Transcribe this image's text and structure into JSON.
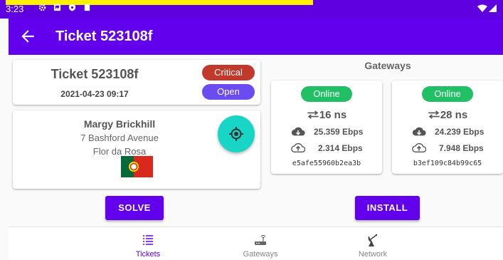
{
  "status_bar": {
    "time": "3:23",
    "icons": [
      "settings-icon",
      "photo-icon",
      "shield-icon",
      "sd-card-icon"
    ],
    "right_icons": [
      "wifi-icon",
      "signal-icon"
    ]
  },
  "app_bar": {
    "title": "Ticket 523108f",
    "back_icon": "arrow-left-icon"
  },
  "ticket": {
    "title": "Ticket 523108f",
    "date": "2021-04-23 09:17",
    "priority": "Critical",
    "status": "Open"
  },
  "contact": {
    "name": "Margy Brickhill",
    "address": "7 Bashford Avenue",
    "city": "Flor da Rosa",
    "flag": "portugal-flag"
  },
  "gateways": {
    "heading": "Gateways",
    "items": [
      {
        "status": "Online",
        "latency": "16 ns",
        "download": "25.359 Ebps",
        "upload": "2.314 Ebps",
        "id": "e5afe55960b2ea3b"
      },
      {
        "status": "Online",
        "latency": "28 ns",
        "download": "24.239 Ebps",
        "upload": "7.948 Ebps",
        "id": "b3ef109c84b99c65"
      }
    ]
  },
  "actions": {
    "solve": "SOLVE",
    "install": "INSTALL"
  },
  "bottom_nav": [
    {
      "label": "Tickets",
      "icon": "list-icon",
      "active": true
    },
    {
      "label": "Gateways",
      "icon": "router-icon",
      "active": false
    },
    {
      "label": "Network",
      "icon": "satellite-dish-icon",
      "active": false
    }
  ],
  "colors": {
    "primary": "#6200ee",
    "status_bar": "#5f00e0",
    "critical": "#c0392b",
    "open": "#6a4cf0",
    "online": "#22c064",
    "fab": "#18d6c6",
    "nav_active": "#6200ee"
  }
}
